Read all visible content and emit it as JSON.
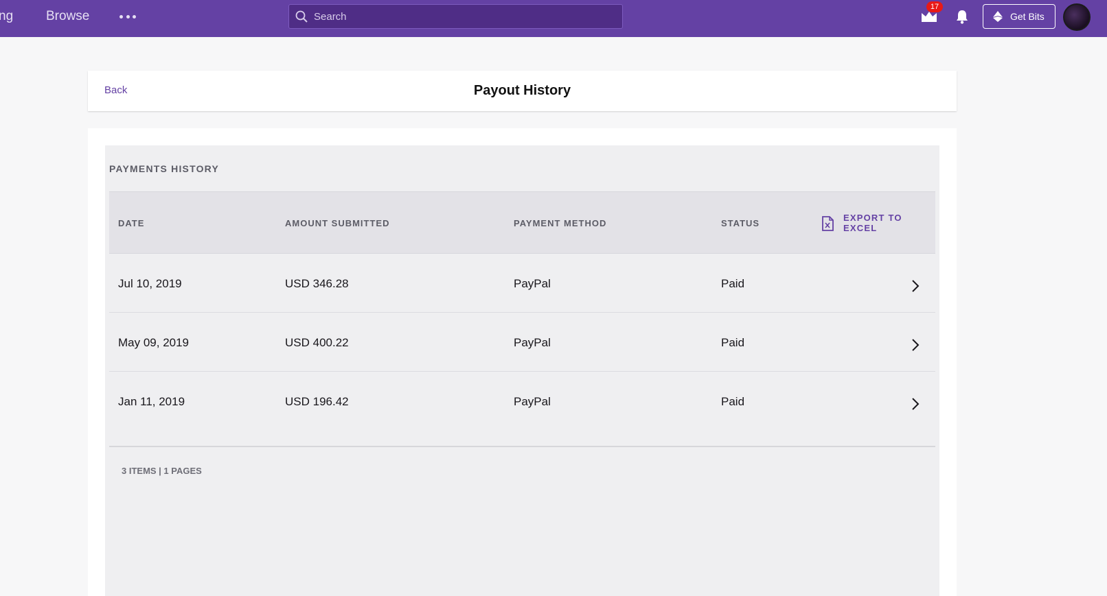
{
  "nav": {
    "partial_link": "ng",
    "browse": "Browse",
    "more_icon": "more-dots-icon",
    "search_placeholder": "Search",
    "prime_badge": "17",
    "get_bits": "Get Bits"
  },
  "header": {
    "back": "Back",
    "title": "Payout History"
  },
  "payments": {
    "section_title": "PAYMENTS HISTORY",
    "columns": {
      "date": "DATE",
      "amount": "AMOUNT SUBMITTED",
      "method": "PAYMENT METHOD",
      "status": "STATUS"
    },
    "export_label": "EXPORT TO EXCEL",
    "rows": [
      {
        "date": "Jul 10, 2019",
        "amount": "USD 346.28",
        "method": "PayPal",
        "status": "Paid"
      },
      {
        "date": "May 09, 2019",
        "amount": "USD 400.22",
        "method": "PayPal",
        "status": "Paid"
      },
      {
        "date": "Jan 11, 2019",
        "amount": "USD 196.42",
        "method": "PayPal",
        "status": "Paid"
      }
    ],
    "pager": "3 ITEMS | 1 PAGES"
  },
  "colors": {
    "brand": "#6441a4",
    "badge": "#e91916",
    "panel": "#efeff1"
  }
}
